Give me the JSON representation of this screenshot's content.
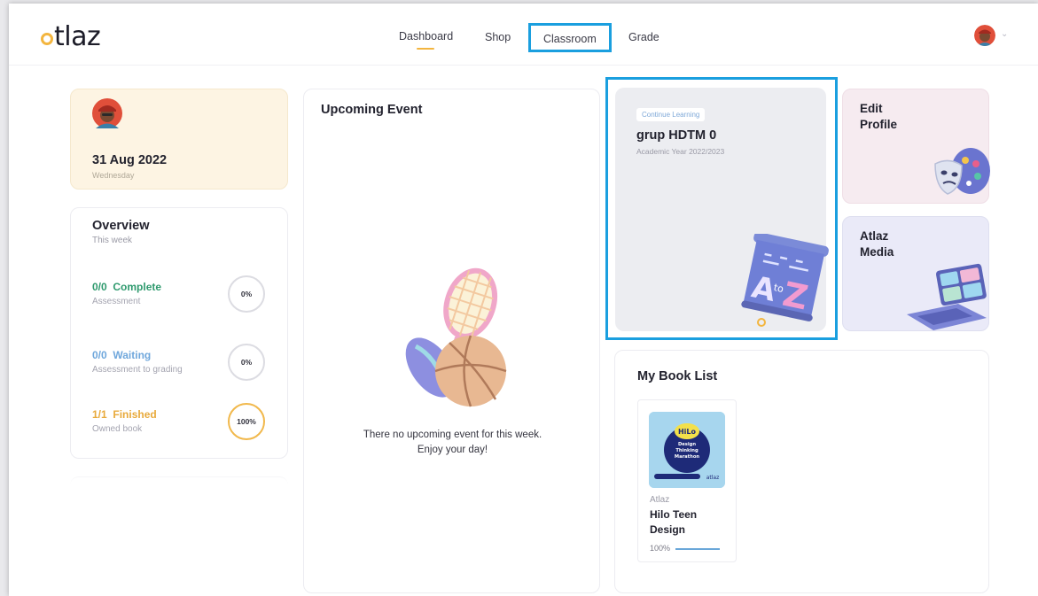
{
  "brand": {
    "logo_text": "tlaz",
    "accent": "#f3b53f"
  },
  "nav": {
    "items": [
      {
        "label": "Dashboard",
        "active": true
      },
      {
        "label": "Shop"
      },
      {
        "label": "Classroom",
        "highlighted": true
      },
      {
        "label": "Grade"
      }
    ],
    "highlight_color": "#1a9fdf"
  },
  "date_card": {
    "date": "31 Aug 2022",
    "day": "Wednesday",
    "bg_color": "#fdf4e3"
  },
  "overview": {
    "title": "Overview",
    "subtitle": "This week",
    "stats": [
      {
        "value": "0/0",
        "status": "Complete",
        "label": "Assessment",
        "percent": "0%",
        "fraction": 0,
        "color": "#2f9a6e"
      },
      {
        "value": "0/0",
        "status": "Waiting",
        "label": "Assessment to grading",
        "percent": "0%",
        "fraction": 0,
        "color": "#6fa7dc"
      },
      {
        "value": "1/1",
        "status": "Finished",
        "label": "Owned book",
        "percent": "100%",
        "fraction": 1,
        "color": "#e8aa3c"
      }
    ]
  },
  "upcoming_event": {
    "title": "Upcoming Event",
    "empty_message": "There no upcoming event for this week. Enjoy your day!"
  },
  "classroom_card": {
    "badge": "Continue Learning",
    "title": "grup HDTM 0",
    "year": "Academic Year 2022/2023",
    "icon": "a-to-z-board-icon"
  },
  "edit_profile": {
    "title": "Edit Profile",
    "icon": "theater-masks-palette-icon",
    "bg_color": "#f6ebf0"
  },
  "atlaz_media": {
    "title": "Atlaz Media",
    "icon": "laptop-media-icon",
    "bg_color": "#eaeaf8"
  },
  "book_list": {
    "title": "My Book List",
    "books": [
      {
        "author": "Atlaz",
        "title": "Hilo Teen Design",
        "progress_label": "100%",
        "progress": 1.0,
        "cover_badge": "HiLo",
        "cover_text": "Design Thinking Marathon",
        "cover_brand": "atlaz"
      }
    ]
  }
}
